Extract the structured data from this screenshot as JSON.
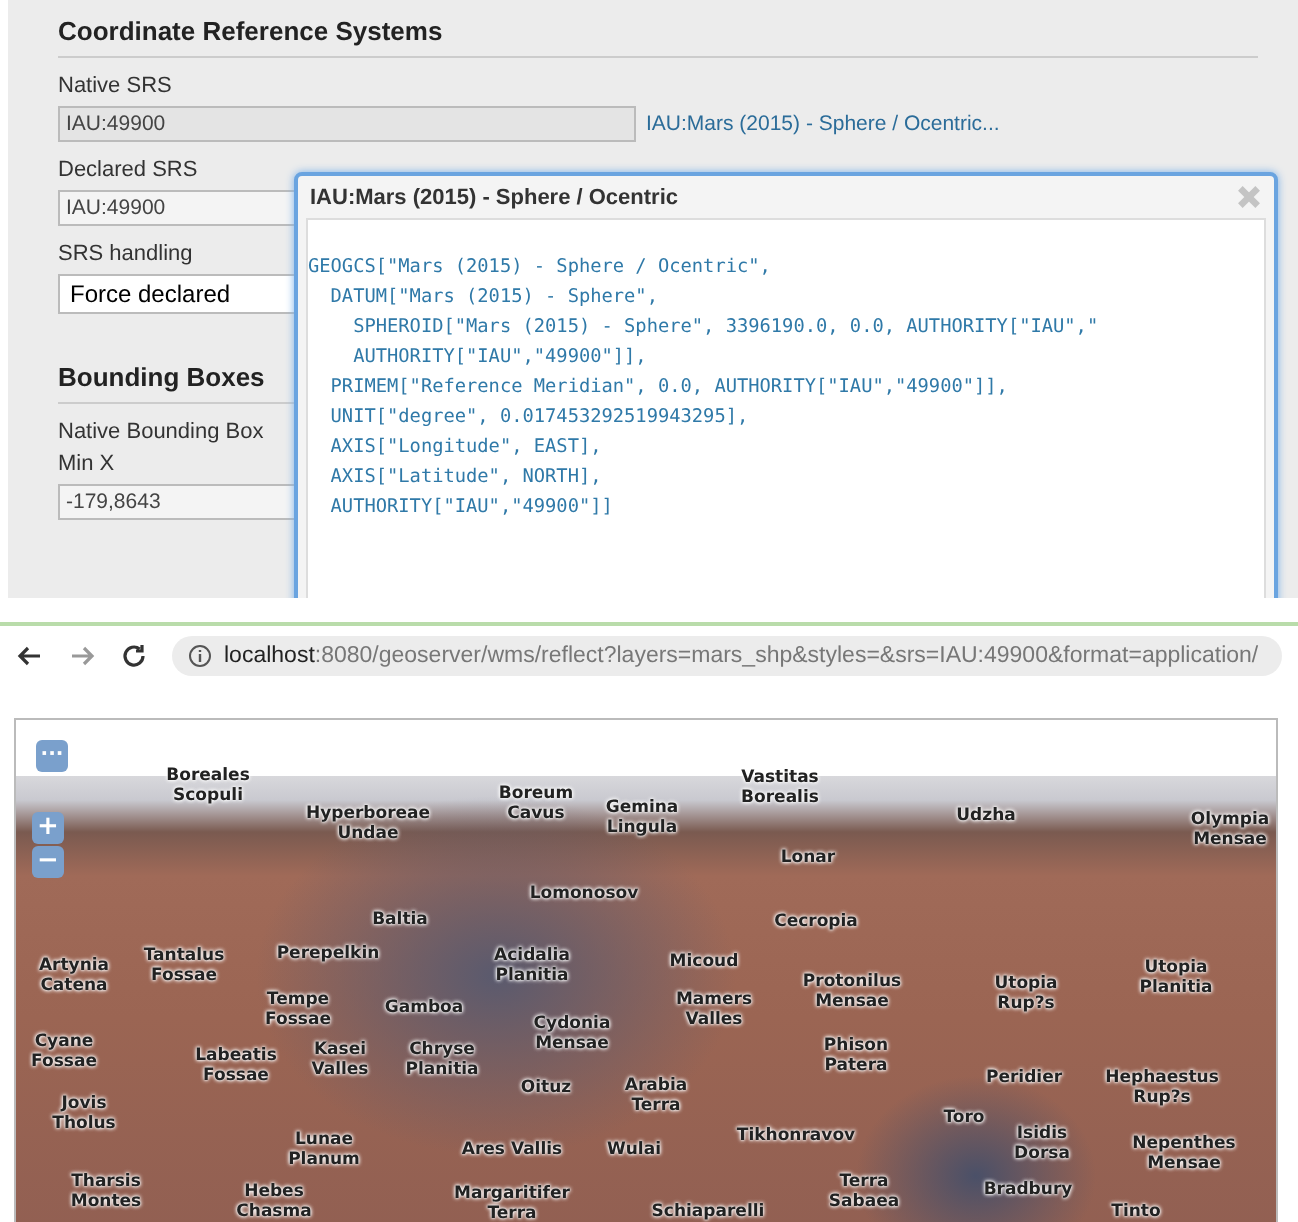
{
  "crs_panel": {
    "heading": "Coordinate Reference Systems",
    "native_srs": {
      "label": "Native SRS",
      "value": "IAU:49900",
      "link": "IAU:Mars (2015) - Sphere / Ocentric..."
    },
    "declared_srs": {
      "label": "Declared SRS",
      "value": "IAU:49900"
    },
    "srs_handling": {
      "label": "SRS handling",
      "value": "Force declared"
    }
  },
  "bbox_panel": {
    "heading": "Bounding Boxes",
    "sublabel": "Native Bounding Box",
    "min_x": {
      "label": "Min X",
      "value": "-179,8643"
    }
  },
  "popup": {
    "title": "IAU:Mars (2015) - Sphere / Ocentric",
    "code_lines": [
      "GEOGCS[\"Mars (2015) - Sphere / Ocentric\",",
      "  DATUM[\"Mars (2015) - Sphere\",",
      "    SPHEROID[\"Mars (2015) - Sphere\", 3396190.0, 0.0, AUTHORITY[\"IAU\",\"",
      "    AUTHORITY[\"IAU\",\"49900\"]],",
      "  PRIMEM[\"Reference Meridian\", 0.0, AUTHORITY[\"IAU\",\"49900\"]],",
      "  UNIT[\"degree\", 0.017453292519943295],",
      "  AXIS[\"Longitude\", EAST],",
      "  AXIS[\"Latitude\", NORTH],",
      "  AUTHORITY[\"IAU\",\"49900\"]]"
    ]
  },
  "browser": {
    "url_host": "localhost",
    "url_rest": ":8080/geoserver/wms/reflect?layers=mars_shp&styles=&srs=IAU:49900&format=application/"
  },
  "map": {
    "menu_button": "···",
    "zoom_in": "+",
    "zoom_out": "−",
    "labels": [
      "Boreales\nScopuli",
      "Hyperboreae\nUndae",
      "Boreum\nCavus",
      "Gemina\nLingula",
      "Vastitas\nBorealis",
      "Udzha",
      "Olympia\nMensae",
      "Lonar",
      "Lomonosov",
      "Cecropia",
      "Baltia",
      "Artynia\nCatena",
      "Tantalus\nFossae",
      "Perepelkin",
      "Acidalia\nPlanitia",
      "Micoud",
      "Mamers\nValles",
      "Protonilus\nMensae",
      "Utopia\nRup?s",
      "Utopia\nPlanitia",
      "Tempe\nFossae",
      "Gamboa",
      "Cydonia\nMensae",
      "Cyane\nFossae",
      "Labeatis\nFossae",
      "Kasei\nValles",
      "Chryse\nPlanitia",
      "Oituz",
      "Arabia\nTerra",
      "Phison\nPatera",
      "Peridier",
      "Hephaestus\nRup?s",
      "Jovis\nTholus",
      "Lunae\nPlanum",
      "Ares Vallis",
      "Wulai",
      "Tikhonravov",
      "Toro",
      "Isidis\nDorsa",
      "Nepenthes\nMensae",
      "Tharsis\nMontes",
      "Hebes\nChasma",
      "Margaritifer\nTerra",
      "Schiaparelli",
      "Terra\nSabaea",
      "Bradbury",
      "Tinto"
    ]
  }
}
